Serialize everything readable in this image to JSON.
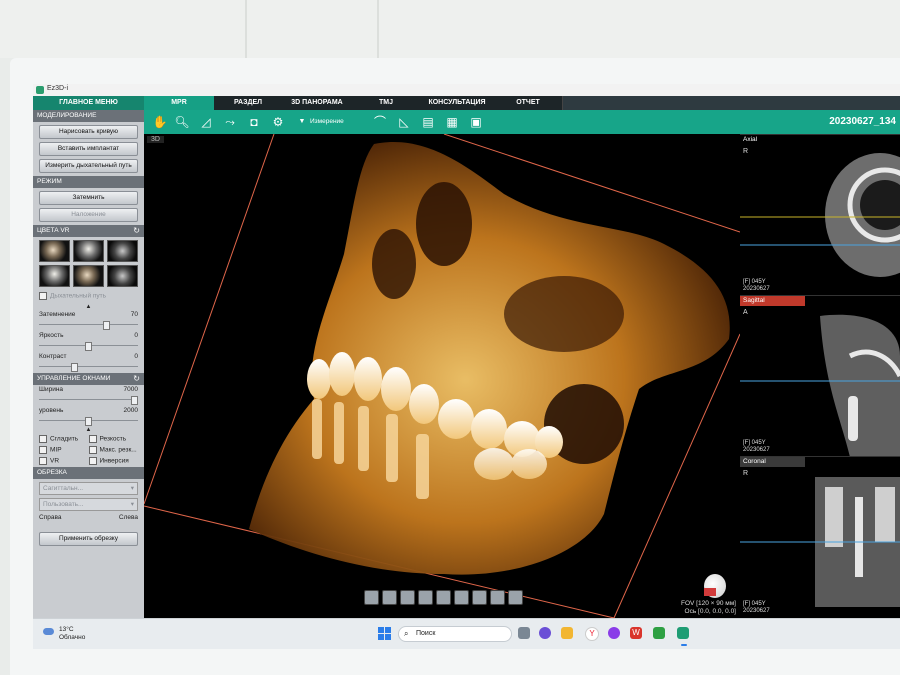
{
  "window": {
    "title": "Ez3D-i"
  },
  "left_panel": {
    "main_menu": "ГЛАВНОЕ МЕНЮ",
    "modeling": {
      "header": "МОДЕЛИРОВАНИЕ",
      "buttons": [
        "Нарисовать кривую",
        "Вставить имплантат",
        "Измерить дыхательный путь"
      ]
    },
    "mode": {
      "header": "РЕЖИМ",
      "buttons": [
        "Затемнить",
        "Наложение"
      ]
    },
    "vr_colors": {
      "header": "ЦВЕТА VR",
      "airway_checkbox": "Дыхательный путь",
      "sliders": [
        {
          "label": "Затемнение",
          "value": "70",
          "level": 0.7
        },
        {
          "label": "Яркость",
          "value": "0",
          "level": 0.5
        },
        {
          "label": "Контраст",
          "value": "0",
          "level": 0.35
        }
      ]
    },
    "window_control": {
      "header": "УПРАВЛЕНИЕ ОКНАМИ",
      "sliders": [
        {
          "label": "Ширина",
          "value": "7000",
          "level": 1.0
        },
        {
          "label": "уровень",
          "value": "2000",
          "level": 0.5
        }
      ],
      "checkboxes": [
        "Сгладить",
        "Резкость",
        "MIP",
        "Макс. резк...",
        "VR",
        "Инверсия"
      ]
    },
    "crop": {
      "header": "ОБРЕЗКА",
      "select_1": "Сагиттальн...",
      "select_2": "Пользовать...",
      "left_label": "Справа",
      "right_label": "Слева",
      "apply_button": "Применить обрезку"
    }
  },
  "tabs": [
    "MPR",
    "РАЗДЕЛ",
    "3D ПАНОРАМА",
    "TMJ",
    "КОНСУЛЬТАЦИЯ",
    "ОТЧЕТ"
  ],
  "active_tab": "MPR",
  "toolbar": {
    "measure_label": "Измерение",
    "study_id": "20230627_134"
  },
  "view3d": {
    "label": "3D",
    "fov_line1": "FOV [120 × 90 мм]",
    "fov_line2": "Ось [0.0, 0.0, 0.0]"
  },
  "mpr_panes": [
    {
      "name": "Axial",
      "letter": "R",
      "info1": "[F] 045Y",
      "info2": "20230627",
      "header_color": "#3a3a3a"
    },
    {
      "name": "Sagittal",
      "letter": "A",
      "info1": "[F] 045Y",
      "info2": "20230627",
      "header_color": "#c0392b"
    },
    {
      "name": "Coronal",
      "letter": "R",
      "info1": "[F] 045Y",
      "info2": "20230627",
      "header_color": "#3a3a3a"
    }
  ],
  "taskbar": {
    "temperature": "13°C",
    "weather": "Облачно",
    "search": "Поиск"
  }
}
